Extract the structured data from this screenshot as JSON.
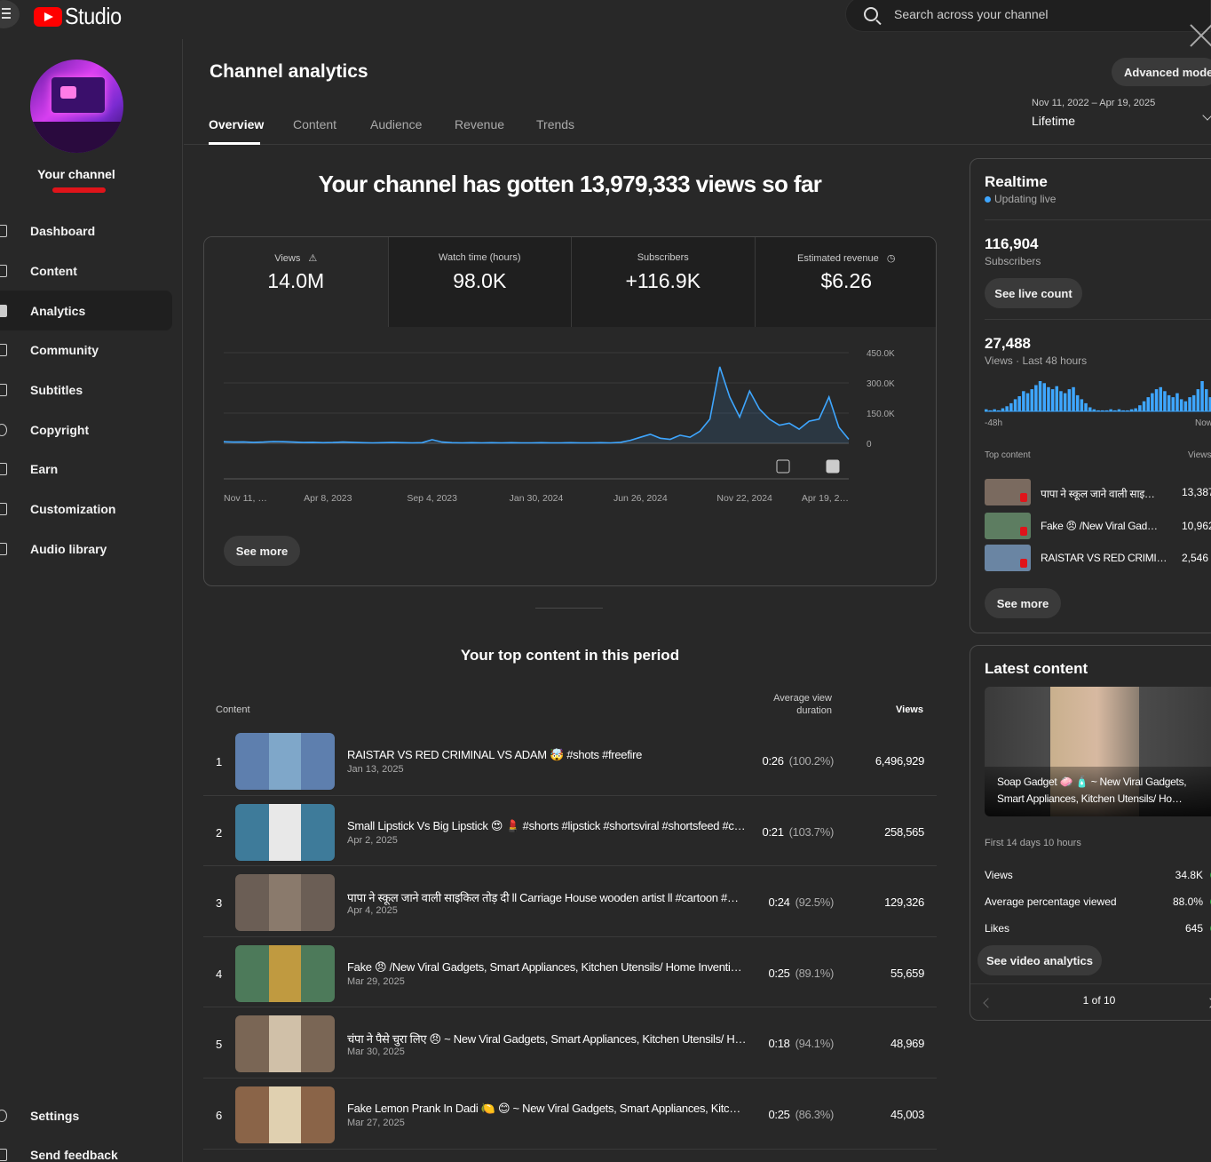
{
  "app": {
    "logo_text": "Studio"
  },
  "search": {
    "placeholder": "Search across your channel"
  },
  "sidebar": {
    "channel_label": "Your channel",
    "items": [
      {
        "label": "Dashboard",
        "icon": "dashboard-icon"
      },
      {
        "label": "Content",
        "icon": "content-icon"
      },
      {
        "label": "Analytics",
        "icon": "analytics-icon",
        "active": true
      },
      {
        "label": "Community",
        "icon": "community-icon"
      },
      {
        "label": "Subtitles",
        "icon": "subtitles-icon"
      },
      {
        "label": "Copyright",
        "icon": "copyright-icon"
      },
      {
        "label": "Earn",
        "icon": "earn-icon"
      },
      {
        "label": "Customization",
        "icon": "customization-icon"
      },
      {
        "label": "Audio library",
        "icon": "audio-library-icon"
      }
    ],
    "bottom": [
      {
        "label": "Settings",
        "icon": "gear-icon"
      },
      {
        "label": "Send feedback",
        "icon": "feedback-icon"
      }
    ]
  },
  "header": {
    "title": "Channel analytics",
    "advanced_mode": "Advanced mode",
    "tabs": [
      "Overview",
      "Content",
      "Audience",
      "Revenue",
      "Trends"
    ],
    "date_range": "Nov 11, 2022 – Apr 19, 2025",
    "date_label": "Lifetime"
  },
  "overview": {
    "headline": "Your channel has gotten 13,979,333 views so far",
    "metrics": [
      {
        "label": "Views",
        "value": "14.0M"
      },
      {
        "label": "Watch time (hours)",
        "value": "98.0K"
      },
      {
        "label": "Subscribers",
        "value": "+116.9K"
      },
      {
        "label": "Estimated revenue",
        "value": "$6.26"
      }
    ],
    "see_more": "See more"
  },
  "chart_data": {
    "type": "line",
    "x_tick_labels": [
      "Nov 11, …",
      "Apr 8, 2023",
      "Sep 4, 2023",
      "Jan 30, 2024",
      "Jun 26, 2024",
      "Nov 22, 2024",
      "Apr 19, 2…"
    ],
    "y_tick_labels": [
      "450.0K",
      "300.0K",
      "150.0K",
      "0"
    ],
    "ylim": [
      0,
      450000
    ],
    "grid": true,
    "series": [
      {
        "color": "#3ea6ff",
        "values": [
          8000,
          6000,
          7000,
          5000,
          6000,
          9000,
          8000,
          6000,
          4000,
          5000,
          3000,
          4000,
          6000,
          5000,
          3000,
          2000,
          3000,
          4000,
          3000,
          2000,
          3000,
          18000,
          6000,
          3000,
          2000,
          3000,
          2000,
          3000,
          2000,
          3000,
          2000,
          2000,
          3000,
          2000,
          2000,
          3000,
          2000,
          2000,
          3000,
          2000,
          5000,
          15000,
          30000,
          45000,
          25000,
          20000,
          40000,
          30000,
          60000,
          120000,
          380000,
          230000,
          130000,
          260000,
          170000,
          120000,
          90000,
          100000,
          70000,
          110000,
          120000,
          230000,
          80000,
          20000
        ]
      }
    ]
  },
  "top_content": {
    "title": "Your top content in this period",
    "headers": {
      "content": "Content",
      "avd": "Average view duration",
      "views": "Views"
    },
    "rows": [
      {
        "rank": "1",
        "title": "RAISTAR VS RED CRIMINAL VS ADAM 🤯 #shots #freefire",
        "date": "Jan 13, 2025",
        "avd": "0:26",
        "pct": "(100.2%)",
        "views": "6,496,929"
      },
      {
        "rank": "2",
        "title": "Small Lipstick Vs Big Lipstick 😍 💄 #shorts #lipstick #shortsviral #shortsfeed #c…",
        "date": "Apr 2, 2025",
        "avd": "0:21",
        "pct": "(103.7%)",
        "views": "258,565"
      },
      {
        "rank": "3",
        "title": "पापा ने स्कूल जाने वाली साइकिल तोड़ दी ll Carriage House wooden artist ll #cartoon #…",
        "date": "Apr 4, 2025",
        "avd": "0:24",
        "pct": "(92.5%)",
        "views": "129,326"
      },
      {
        "rank": "4",
        "title": "Fake 😠 /New Viral Gadgets, Smart Appliances, Kitchen Utensils/ Home Inventio…",
        "date": "Mar 29, 2025",
        "avd": "0:25",
        "pct": "(89.1%)",
        "views": "55,659"
      },
      {
        "rank": "5",
        "title": "चंपा ने पैसे चुरा लिए 😠 ~ New Viral Gadgets, Smart Appliances, Kitchen Utensils/ H…",
        "date": "Mar 30, 2025",
        "avd": "0:18",
        "pct": "(94.1%)",
        "views": "48,969"
      },
      {
        "rank": "6",
        "title": "Fake Lemon Prank In Dadi 🍋 😊 ~ New Viral Gadgets, Smart Appliances, Kitchen…",
        "date": "Mar 27, 2025",
        "avd": "0:25",
        "pct": "(86.3%)",
        "views": "45,003"
      }
    ]
  },
  "realtime": {
    "title": "Realtime",
    "status": "Updating live",
    "subscribers_value": "116,904",
    "subscribers_label": "Subscribers",
    "see_live_count": "See live count",
    "views_value": "27,488",
    "views_label": "Views · Last 48 hours",
    "axis_start": "-48h",
    "axis_end": "Now",
    "bars": [
      2,
      1,
      2,
      1,
      3,
      5,
      8,
      12,
      15,
      20,
      18,
      22,
      26,
      30,
      28,
      24,
      22,
      25,
      20,
      18,
      22,
      24,
      16,
      12,
      8,
      4,
      2,
      1,
      1,
      1,
      2,
      1,
      2,
      1,
      1,
      2,
      3,
      6,
      10,
      14,
      18,
      22,
      24,
      20,
      16,
      14,
      18,
      12,
      10,
      14,
      16,
      22,
      30,
      22,
      14,
      6
    ],
    "top_content_label": "Top content",
    "top_views_label": "Views",
    "top_items": [
      {
        "title": "पापा ने स्कूल जाने वाली साइ…",
        "views": "13,387"
      },
      {
        "title": "Fake 😠 /New Viral Gad…",
        "views": "10,962"
      },
      {
        "title": "RAISTAR VS RED CRIMIN…",
        "views": "2,546"
      }
    ],
    "see_more": "See more"
  },
  "latest": {
    "title": "Latest content",
    "video_title": "Soap Gadget 🧼 🧴 ~ New Viral Gadgets, Smart Appliances, Kitchen Utensils/ Ho…",
    "period": "First 14 days 10 hours",
    "stats": [
      {
        "label": "Views",
        "value": "34.8K"
      },
      {
        "label": "Average percentage viewed",
        "value": "88.0%"
      },
      {
        "label": "Likes",
        "value": "645"
      }
    ],
    "see_video_analytics": "See video analytics",
    "pager": "1 of 10"
  }
}
